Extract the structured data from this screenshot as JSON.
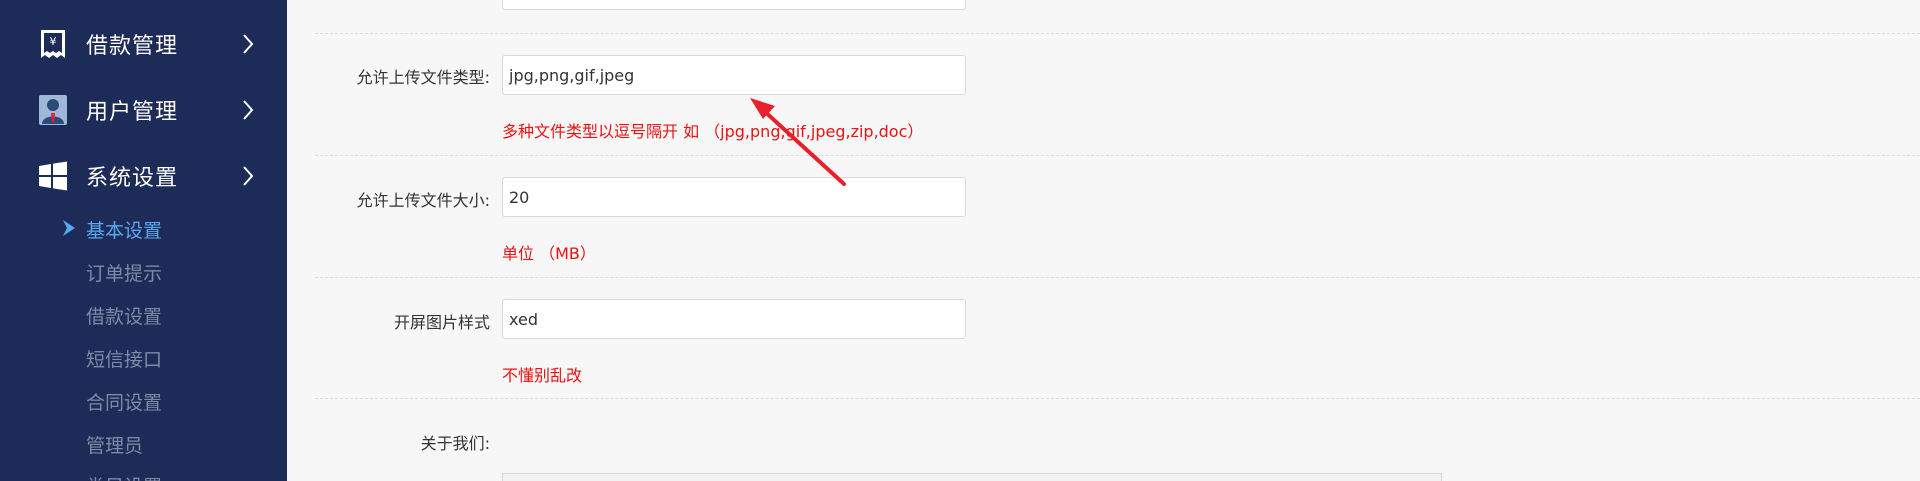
{
  "sidebar": {
    "menu": [
      {
        "label": "借款管理",
        "icon": "receipt-yen-icon"
      },
      {
        "label": "用户管理",
        "icon": "user-icon"
      },
      {
        "label": "系统设置",
        "icon": "windows-icon"
      }
    ],
    "submenu": [
      {
        "label": "基本设置",
        "active": true
      },
      {
        "label": "订单提示",
        "active": false
      },
      {
        "label": "借款设置",
        "active": false
      },
      {
        "label": "短信接口",
        "active": false
      },
      {
        "label": "合同设置",
        "active": false
      },
      {
        "label": "管理员",
        "active": false
      },
      {
        "label": "类目设置",
        "active": false
      }
    ]
  },
  "form": {
    "file_types": {
      "label": "允许上传文件类型:",
      "value": "jpg,png,gif,jpeg",
      "hint": "多种文件类型以逗号隔开 如 （jpg,png,gif,jpeg,zip,doc）"
    },
    "file_size": {
      "label": "允许上传文件大小:",
      "value": "20",
      "hint": "单位 （MB）"
    },
    "splash_style": {
      "label": "开屏图片样式",
      "value": "xed",
      "hint": "不懂别乱改"
    },
    "about_us": {
      "label": "关于我们:"
    }
  },
  "colors": {
    "sidebar_bg": "#1c2b57",
    "active_submenu": "#5aa9f0",
    "hint_red": "#ee1111",
    "annotation_arrow": "#e8202a"
  }
}
